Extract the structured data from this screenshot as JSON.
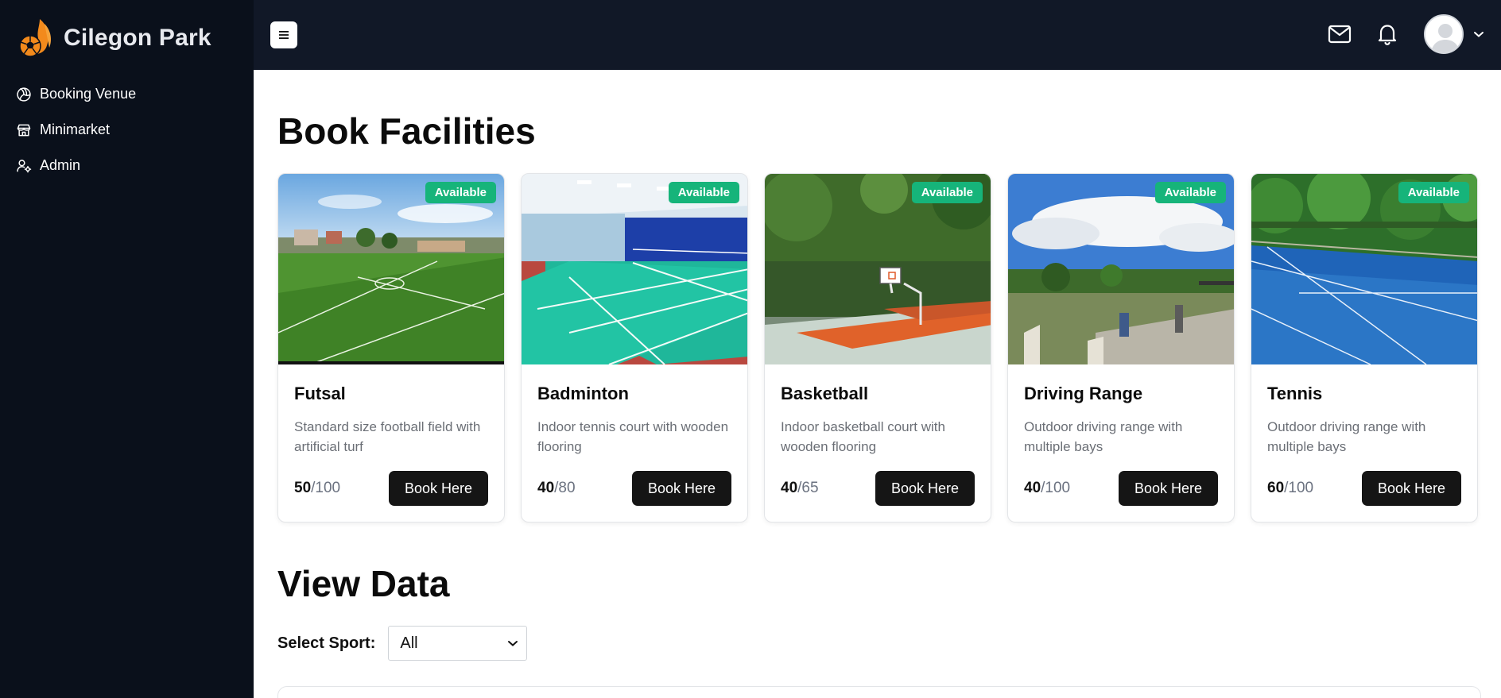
{
  "brand": {
    "name": "Cilegon Park"
  },
  "sidebar": {
    "items": [
      {
        "label": "Booking Venue",
        "icon": "volleyball-icon"
      },
      {
        "label": "Minimarket",
        "icon": "store-icon"
      },
      {
        "label": "Admin",
        "icon": "user-cog-icon"
      }
    ]
  },
  "topbar": {
    "icons": [
      "menu-icon",
      "mail-icon",
      "bell-icon",
      "avatar",
      "chevron-down-icon"
    ]
  },
  "main": {
    "facilities_title": "Book Facilities",
    "view_data_title": "View Data",
    "select_label": "Select Sport:",
    "select_value": "All",
    "cards": [
      {
        "badge": "Available",
        "title": "Futsal",
        "desc": "Standard size football field with artificial turf",
        "current": "50",
        "capacity": "/100",
        "button": "Book Here"
      },
      {
        "badge": "Available",
        "title": "Badminton",
        "desc": "Indoor tennis court with wooden flooring",
        "current": "40",
        "capacity": "/80",
        "button": "Book Here"
      },
      {
        "badge": "Available",
        "title": "Basketball",
        "desc": "Indoor basketball court with wooden flooring",
        "current": "40",
        "capacity": "/65",
        "button": "Book Here"
      },
      {
        "badge": "Available",
        "title": "Driving Range",
        "desc": "Outdoor driving range with multiple bays",
        "current": "40",
        "capacity": "/100",
        "button": "Book Here"
      },
      {
        "badge": "Available",
        "title": "Tennis",
        "desc": "Outdoor driving range with multiple bays",
        "current": "60",
        "capacity": "/100",
        "button": "Book Here"
      }
    ]
  },
  "colors": {
    "sidebar_bg": "#0a101b",
    "topbar_bg": "#111827",
    "badge_green": "#16b47a",
    "button_dark": "#151515",
    "brand_orange": "#f28a1c"
  }
}
